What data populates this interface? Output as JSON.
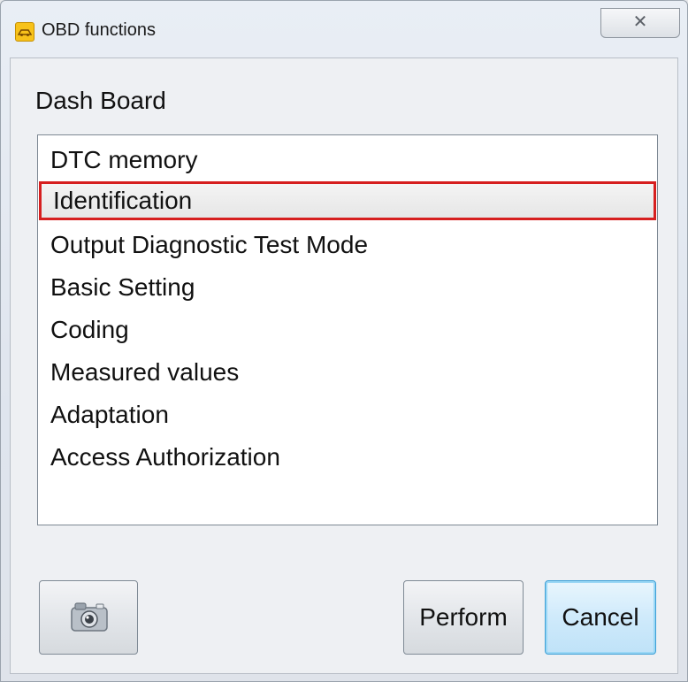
{
  "window": {
    "title": "OBD functions",
    "close_glyph": "✕"
  },
  "section": {
    "title": "Dash Board"
  },
  "functions": {
    "items": [
      "DTC memory",
      "Identification",
      "Output Diagnostic Test Mode",
      "Basic Setting",
      "Coding",
      "Measured values",
      "Adaptation",
      "Access Authorization"
    ],
    "selected": "Identification"
  },
  "buttons": {
    "camera_icon": "camera-icon",
    "perform": "Perform",
    "cancel": "Cancel"
  },
  "colors": {
    "selection_border": "#d61f1f",
    "focus_border": "#3c9fd6",
    "app_icon": "#f7c21a"
  }
}
